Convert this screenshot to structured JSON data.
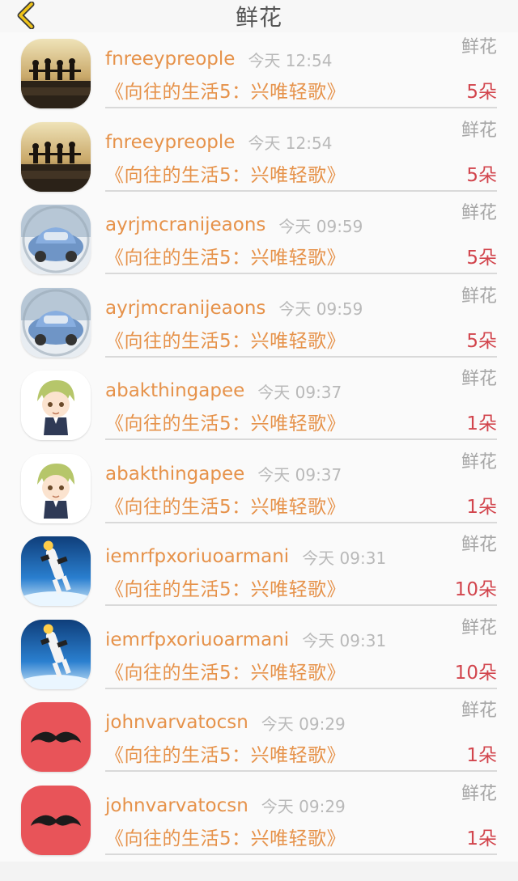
{
  "header": {
    "title": "鲜花",
    "back_icon": "chevron-left-icon",
    "accent": "#f0c419"
  },
  "list": [
    {
      "user": "fnreeypreople",
      "time": "今天 12:54",
      "gift": "鲜花",
      "show": "《向往的生活5：兴唯轻歌》",
      "count": "5朵",
      "avatar": "sunset-silhouette"
    },
    {
      "user": "fnreeypreople",
      "time": "今天 12:54",
      "gift": "鲜花",
      "show": "《向往的生活5：兴唯轻歌》",
      "count": "5朵",
      "avatar": "sunset-silhouette"
    },
    {
      "user": "ayrjmcranijeaons",
      "time": "今天 09:59",
      "gift": "鲜花",
      "show": "《向往的生活5：兴唯轻歌》",
      "count": "5朵",
      "avatar": "blue-car"
    },
    {
      "user": "ayrjmcranijeaons",
      "time": "今天 09:59",
      "gift": "鲜花",
      "show": "《向往的生活5：兴唯轻歌》",
      "count": "5朵",
      "avatar": "blue-car"
    },
    {
      "user": "abakthingapee",
      "time": "今天 09:37",
      "gift": "鲜花",
      "show": "《向往的生活5：兴唯轻歌》",
      "count": "1朵",
      "avatar": "anime-boy"
    },
    {
      "user": "abakthingapee",
      "time": "今天 09:37",
      "gift": "鲜花",
      "show": "《向往的生活5：兴唯轻歌》",
      "count": "1朵",
      "avatar": "anime-boy"
    },
    {
      "user": "iemrfpxoriuoarmani",
      "time": "今天 09:31",
      "gift": "鲜花",
      "show": "《向往的生活5：兴唯轻歌》",
      "count": "10朵",
      "avatar": "skydiver"
    },
    {
      "user": "iemrfpxoriuoarmani",
      "time": "今天 09:31",
      "gift": "鲜花",
      "show": "《向往的生活5：兴唯轻歌》",
      "count": "10朵",
      "avatar": "skydiver"
    },
    {
      "user": "johnvarvatocsn",
      "time": "今天 09:29",
      "gift": "鲜花",
      "show": "《向往的生活5：兴唯轻歌》",
      "count": "1朵",
      "avatar": "mustache"
    },
    {
      "user": "johnvarvatocsn",
      "time": "今天 09:29",
      "gift": "鲜花",
      "show": "《向往的生活5：兴唯轻歌》",
      "count": "1朵",
      "avatar": "mustache"
    }
  ]
}
